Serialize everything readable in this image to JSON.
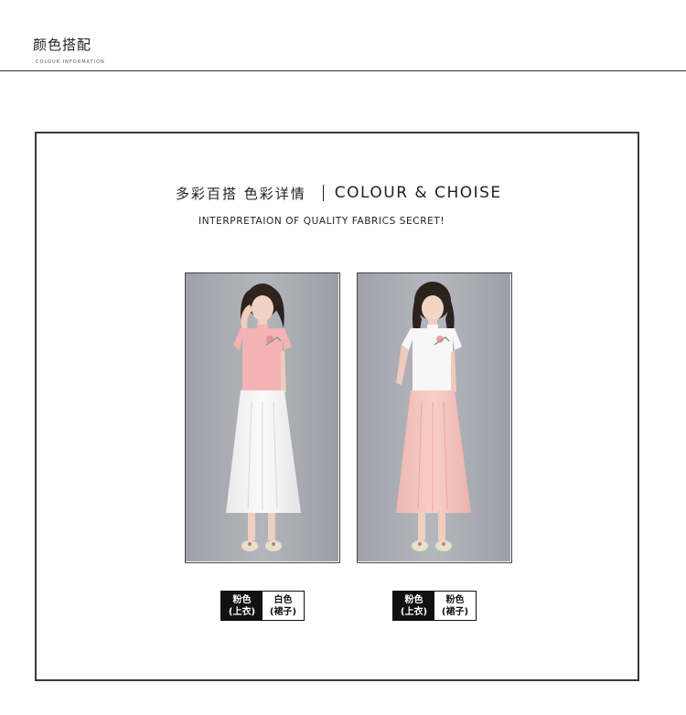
{
  "section": {
    "title": "颜色搭配",
    "subtitle": "COLOUR INFORMATION"
  },
  "headline": {
    "cn": "多彩百搭 色彩详情",
    "en": "COLOUR & CHOISE",
    "tagline": "INTERPRETAION OF QUALITY FABRICS SECRET!"
  },
  "colors": {
    "pink_top": "#f5b7b8",
    "white": "#fafafa",
    "pink_skirt": "#f6c6c2",
    "backdrop": "#a9aab2"
  },
  "options": [
    {
      "top_color": "粉色",
      "top_part": "(上衣)",
      "skirt_color": "白色",
      "skirt_part": "(裙子)"
    },
    {
      "top_color": "粉色",
      "top_part": "(上衣)",
      "skirt_color": "粉色",
      "skirt_part": "(裙子)"
    }
  ]
}
